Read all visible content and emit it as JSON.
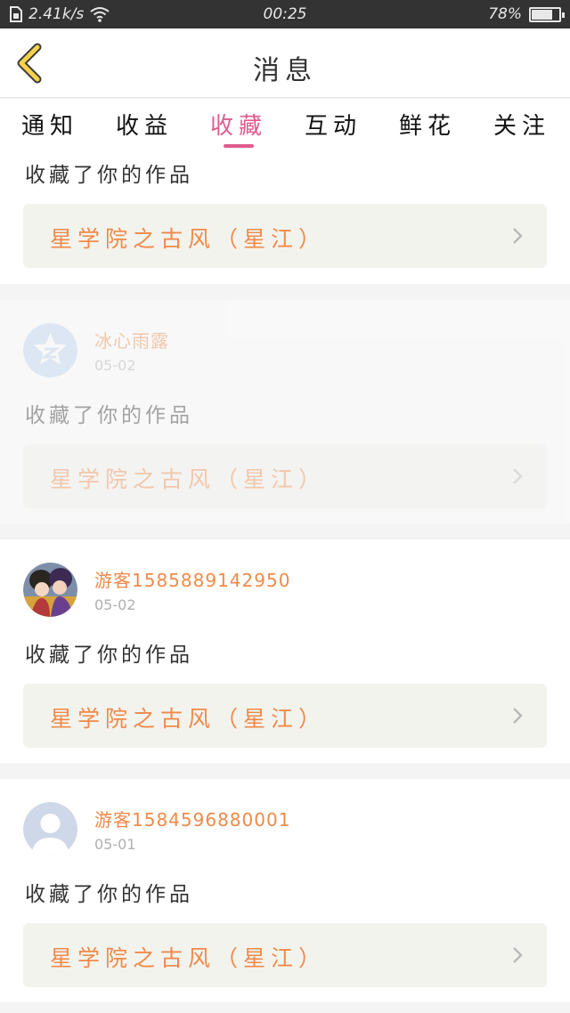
{
  "status_bar": {
    "speed": "2.41k/s",
    "time": "00:25",
    "battery": "78%",
    "battery_level": 0.78
  },
  "header": {
    "title": "消息",
    "back_icon": "chevron-left-icon"
  },
  "tabs": [
    {
      "label": "通知",
      "active": false
    },
    {
      "label": "收益",
      "active": false
    },
    {
      "label": "收藏",
      "active": true
    },
    {
      "label": "互动",
      "active": false
    },
    {
      "label": "鲜花",
      "active": false
    },
    {
      "label": "关注",
      "active": false
    }
  ],
  "messages": [
    {
      "username": "",
      "date": "",
      "action": "收藏了你的作品",
      "work": "星学院之古风（星江）",
      "faded": false
    },
    {
      "username": "冰心雨露",
      "date": "05-02",
      "action": "收藏了你的作品",
      "work": "星学院之古风（星江）",
      "faded": true
    },
    {
      "username": "游客1585889142950",
      "date": "05-02",
      "action": "收藏了你的作品",
      "work": "星学院之古风（星江）",
      "faded": false
    },
    {
      "username": "游客1584596880001",
      "date": "05-01",
      "action": "收藏了你的作品",
      "work": "星学院之古风（星江）",
      "faded": false
    }
  ],
  "colors": {
    "accent": "#e05c8e",
    "username": "#f08a49",
    "back_icon": "#f6d24a"
  }
}
